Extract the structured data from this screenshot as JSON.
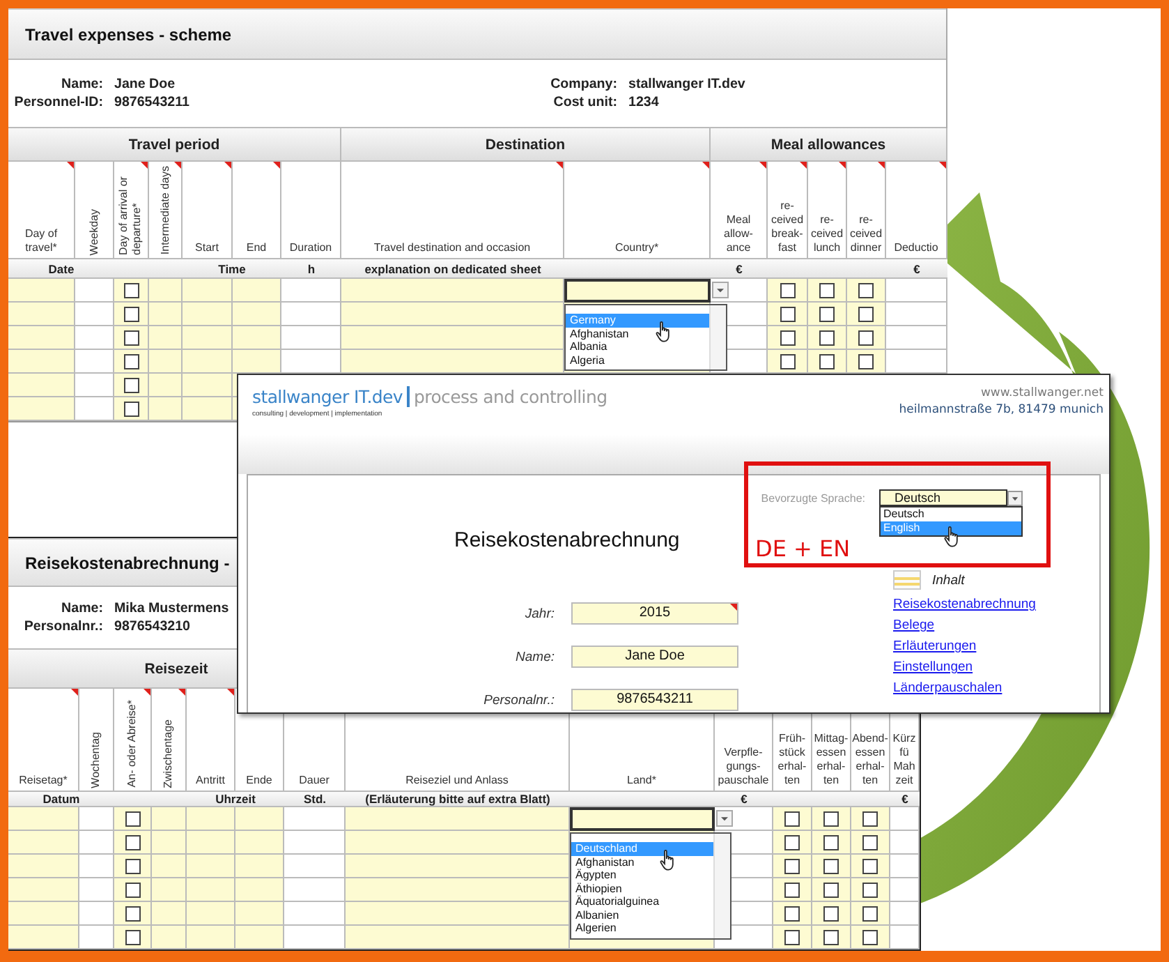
{
  "sheets": [
    {
      "title": "Travel expenses - scheme",
      "info_left": [
        {
          "label": "Name:",
          "value": "Jane Doe"
        },
        {
          "label": "Personnel-ID:",
          "value": "9876543211"
        }
      ],
      "info_right": [
        {
          "label": "Company:",
          "value": "stallwanger IT.dev"
        },
        {
          "label": "Cost unit:",
          "value": "1234"
        }
      ],
      "groups": [
        "Travel period",
        "Destination",
        "Meal allowances"
      ],
      "columns": [
        {
          "label": "Day of travel*",
          "kind": "horizontal",
          "comment": true
        },
        {
          "label": "Weekday",
          "kind": "vertical",
          "comment": false
        },
        {
          "label": "Day of arrival or departure*",
          "kind": "vertical",
          "comment": true
        },
        {
          "label": "Intermediate days",
          "kind": "vertical",
          "comment": true
        },
        {
          "label": "Start",
          "kind": "horizontal",
          "comment": true
        },
        {
          "label": "End",
          "kind": "horizontal",
          "comment": true
        },
        {
          "label": "Duration",
          "kind": "horizontal",
          "comment": false
        },
        {
          "label": "Travel destination and occasion",
          "kind": "horizontal",
          "comment": true
        },
        {
          "label": "Country*",
          "kind": "horizontal",
          "comment": true
        },
        {
          "label": "Meal allow-ance",
          "kind": "horizontal",
          "comment": true
        },
        {
          "label": "re-ceived break-fast",
          "kind": "horizontal",
          "comment": true
        },
        {
          "label": "re-ceived lunch",
          "kind": "horizontal",
          "comment": true
        },
        {
          "label": "re-ceived dinner",
          "kind": "horizontal",
          "comment": true
        },
        {
          "label": "Deductio",
          "kind": "horizontal",
          "comment": true
        }
      ],
      "units": [
        "Date",
        "Time",
        "h",
        "explanation on dedicated sheet",
        "€",
        "€"
      ],
      "rows": [
        {
          "checks": [
            false,
            false,
            false,
            false
          ]
        },
        {
          "checks": [
            false,
            false,
            false,
            false
          ]
        },
        {
          "checks": [
            false,
            false,
            false,
            false
          ]
        },
        {
          "checks": [
            false,
            false,
            false,
            false
          ]
        },
        {
          "checks": [
            false
          ]
        },
        {
          "checks": [
            false
          ]
        }
      ],
      "options": [
        {
          "label": "Germany",
          "selected": true
        },
        {
          "label": "Afghanistan",
          "selected": false
        },
        {
          "label": "Albania",
          "selected": false
        },
        {
          "label": "Algeria",
          "selected": false
        }
      ]
    },
    {
      "title": "Reisekostenabrechnung -",
      "info_left": [
        {
          "label": "Name:",
          "value": "Mika Mustermens"
        },
        {
          "label": "Personalnr.:",
          "value": "9876543210"
        }
      ],
      "groups": [
        "Reisezeit"
      ],
      "columns": [
        {
          "label": "Reisetag*",
          "kind": "horizontal",
          "comment": true
        },
        {
          "label": "Wochentag",
          "kind": "vertical",
          "comment": false
        },
        {
          "label": "An- oder Abreise*",
          "kind": "vertical",
          "comment": true
        },
        {
          "label": "Zwischentage",
          "kind": "vertical",
          "comment": true
        },
        {
          "label": "Antritt",
          "kind": "horizontal",
          "comment": true
        },
        {
          "label": "Ende",
          "kind": "horizontal"
        },
        {
          "label": "Dauer",
          "kind": "horizontal"
        },
        {
          "label": "Reiseziel und Anlass",
          "kind": "horizontal"
        },
        {
          "label": "Land*",
          "kind": "horizontal"
        },
        {
          "label": "Verpfle-gungs-pauschale",
          "kind": "horizontal"
        },
        {
          "label": "Früh-stück erhal-ten",
          "kind": "horizontal"
        },
        {
          "label": "Mittag-essen erhal-ten",
          "kind": "horizontal"
        },
        {
          "label": "Abend-essen erhal-ten",
          "kind": "horizontal"
        },
        {
          "label": "Kürz fü Mah zeit",
          "kind": "horizontal"
        }
      ],
      "units": [
        "Datum",
        "Uhrzeit",
        "Std.",
        "(Erläuterung bitte auf extra Blatt)",
        "€",
        "€"
      ],
      "rows": [
        {
          "checks": [
            false,
            false,
            false,
            false
          ]
        },
        {
          "checks": [
            false,
            false,
            false,
            false
          ]
        },
        {
          "checks": [
            false,
            false,
            false,
            false
          ]
        },
        {
          "checks": [
            false,
            false,
            false,
            false
          ]
        },
        {
          "checks": [
            false,
            false,
            false,
            false
          ]
        },
        {
          "checks": [
            false,
            false,
            false,
            false
          ]
        }
      ],
      "options": [
        {
          "label": "Deutschland",
          "selected": true
        },
        {
          "label": "Afghanistan",
          "selected": false
        },
        {
          "label": "Ägypten",
          "selected": false
        },
        {
          "label": "Äthiopien",
          "selected": false
        },
        {
          "label": "Äquatorialguinea",
          "selected": false
        },
        {
          "label": "Albanien",
          "selected": false
        },
        {
          "label": "Algerien",
          "selected": false
        }
      ]
    }
  ],
  "dialog": {
    "brand": "stallwanger IT.dev",
    "tagline": "process and controlling",
    "subline": "consulting | development | implementation",
    "website": "www.stallwanger.net",
    "address": "heilmannstraße 7b, 81479 munich",
    "language_label": "Bevorzugte Sprache:",
    "language_value": "Deutsch",
    "language_options": [
      {
        "label": "Deutsch",
        "selected": false
      },
      {
        "label": "English",
        "selected": true
      }
    ],
    "annotation": "DE + EN",
    "title": "Reisekostenabrechnung",
    "fields": [
      {
        "label": "Jahr:",
        "value": "2015",
        "comment": true
      },
      {
        "label": "Name:",
        "value": "Jane Doe",
        "comment": false
      },
      {
        "label": "Personalnr.:",
        "value": "9876543211",
        "comment": false
      }
    ],
    "contents_title": "Inhalt",
    "links": [
      "Reisekostenabrechnung",
      "Belege",
      "Erläuterungen",
      "Einstellungen",
      "Länderpauschalen"
    ]
  }
}
